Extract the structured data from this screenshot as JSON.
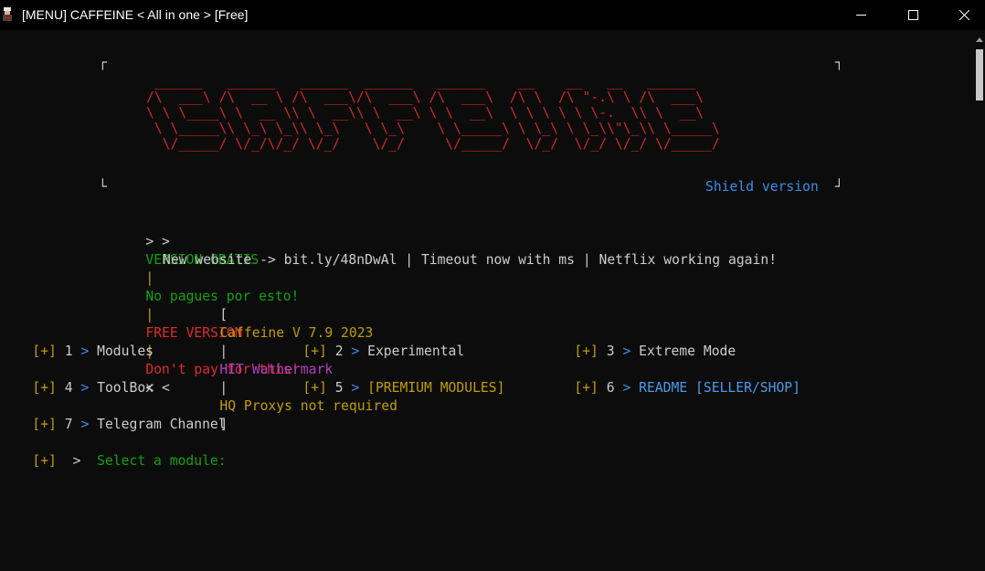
{
  "window": {
    "title": "[MENU] CAFFEINE < All in one > [Free]",
    "icon": "terminal-app-icon",
    "minimize_glyph": "—",
    "maximize_glyph": "☐",
    "close_glyph": "✕"
  },
  "banner": {
    "ascii_art": " ______   ______   ______  ______   ______    __    __   __   ______\n/\\  ___\\ /\\  __ \\ /\\  ___\\/\\  ___\\ /\\  ___\\  /\\ \\  /\\ \"-.\\ \\ /\\  ___\\\n\\ \\ \\____\\ \\  __ \\\\ \\  __\\\\ \\  __\\ \\ \\  __\\  \\ \\ \\ \\ \\ \\-.  \\\\ \\  __\\\n \\ \\_____\\\\ \\_\\ \\_\\\\ \\_\\   \\ \\_\\    \\ \\_____\\ \\ \\_\\ \\ \\_\\\\\"\\_\\\\ \\_____\\\n  \\/_____/ \\/_/\\/_/ \\/_/    \\/_/     \\/_____/  \\/_/  \\/_/ \\/_/ \\/_____/",
    "corner_tl": "┌",
    "corner_tr": "┐",
    "corner_bl": "└",
    "corner_br": "┘",
    "shield_version": "Shield version"
  },
  "info": {
    "line1": {
      "prefix": "> >",
      "es_free": "VERSION GRATIS",
      "sep1": "|",
      "es_no_pay": "No pagues por esto!",
      "sep2": "|",
      "en_free": "FREE VERSION",
      "sep3": "|",
      "en_no_pay": "Don't pay for this!",
      "suffix": "< <"
    },
    "line2": "New website -> bit.ly/48nDwAl | Timeout now with ms | Netflix working again!",
    "line3": {
      "open": "[",
      "version": "Caffeine V 7.9 2023",
      "sep1": "|",
      "hit": "HIT Wathermark",
      "sep2": "|",
      "proxies": "HQ Proxys not required",
      "close": "]"
    }
  },
  "menu": {
    "marker": "[+]",
    "arrow": ">",
    "items": [
      {
        "num": "1",
        "label": "Modules"
      },
      {
        "num": "2",
        "label": "Experimental"
      },
      {
        "num": "3",
        "label": "Extreme Mode"
      },
      {
        "num": "4",
        "label": "ToolBox"
      },
      {
        "num": "5",
        "label": "[PREMIUM MODULES]"
      },
      {
        "num": "6",
        "label": "README [SELLER/SHOP]"
      },
      {
        "num": "7",
        "label": "Telegram Channel"
      }
    ]
  },
  "prompt": {
    "marker": "[+]",
    "arrow": ">",
    "text": "Select a module:"
  },
  "colors": {
    "background": "#0c0c0c",
    "text": "#cccccc",
    "green": "#13a10e",
    "red": "#e02a2a",
    "yellow": "#c19c00",
    "blue": "#3b8eea",
    "magenta": "#b23fc0"
  }
}
